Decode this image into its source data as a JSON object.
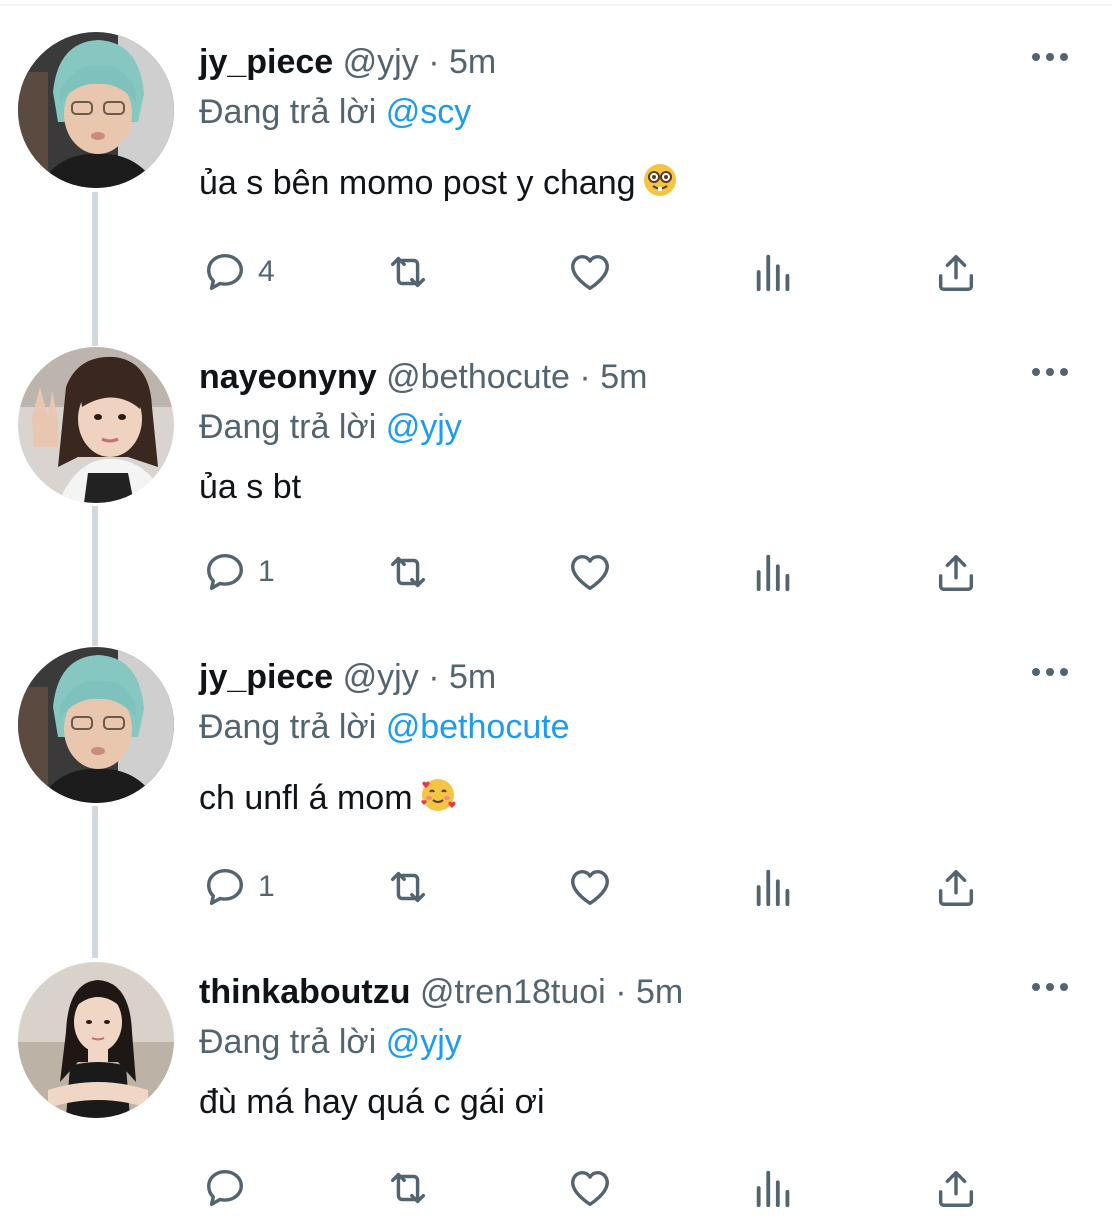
{
  "tweets": [
    {
      "name": "jy_piece",
      "handle": "@yjy",
      "separator": "·",
      "time": "5m",
      "reply_prefix": "Đang trả lời",
      "reply_to": "@scy",
      "text": "ủa s bên momo post y chang",
      "emoji": "nerd-face",
      "reply_count": "4",
      "avatar": "teal-hair-avatar"
    },
    {
      "name": "nayeonyny",
      "handle": "@bethocute",
      "separator": "·",
      "time": "5m",
      "reply_prefix": "Đang trả lời",
      "reply_to": "@yjy",
      "text": "ủa s bt",
      "emoji": "",
      "reply_count": "1",
      "avatar": "peace-sign-avatar"
    },
    {
      "name": "jy_piece",
      "handle": "@yjy",
      "separator": "·",
      "time": "5m",
      "reply_prefix": "Đang trả lời",
      "reply_to": "@bethocute",
      "text": "ch unfl á mom",
      "emoji": "smiling-face-with-hearts",
      "reply_count": "1",
      "avatar": "teal-hair-avatar"
    },
    {
      "name": "thinkaboutzu",
      "handle": "@tren18tuoi",
      "separator": "·",
      "time": "5m",
      "reply_prefix": "Đang trả lời",
      "reply_to": "@yjy",
      "text": "đù má hay quá c gái ơi",
      "emoji": "",
      "reply_count": "",
      "avatar": "dark-hair-avatar"
    }
  ],
  "colors": {
    "name": "#0f1419",
    "secondary": "#536471",
    "mention": "#1d9bf0",
    "thread_line": "#cfd9de"
  }
}
